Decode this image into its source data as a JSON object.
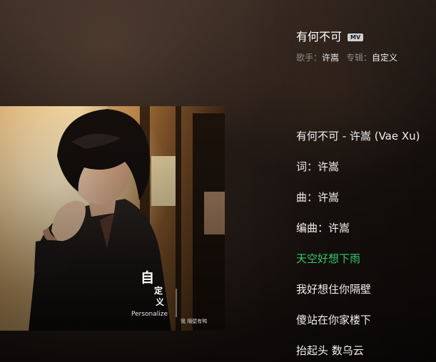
{
  "song": {
    "title": "有何不可",
    "mv_badge": "MV",
    "singer_label": "歌手：",
    "singer": "许嵩",
    "album_label": "专辑：",
    "album": "自定义"
  },
  "cover": {
    "art_title_1": "自",
    "art_title_2": "定",
    "art_title_3": "义",
    "art_subtitle": "Personalize",
    "art_caption": "我 隔壁有鸭"
  },
  "lyrics": {
    "active_index": 4,
    "active_color": "#33c86a",
    "lines": [
      "有何不可 - 许嵩 (Vae Xu)",
      "词：许嵩",
      "曲：许嵩",
      "编曲：许嵩",
      "天空好想下雨",
      "我好想住你隔壁",
      "傻站在你家楼下",
      "抬起头 数乌云"
    ]
  }
}
